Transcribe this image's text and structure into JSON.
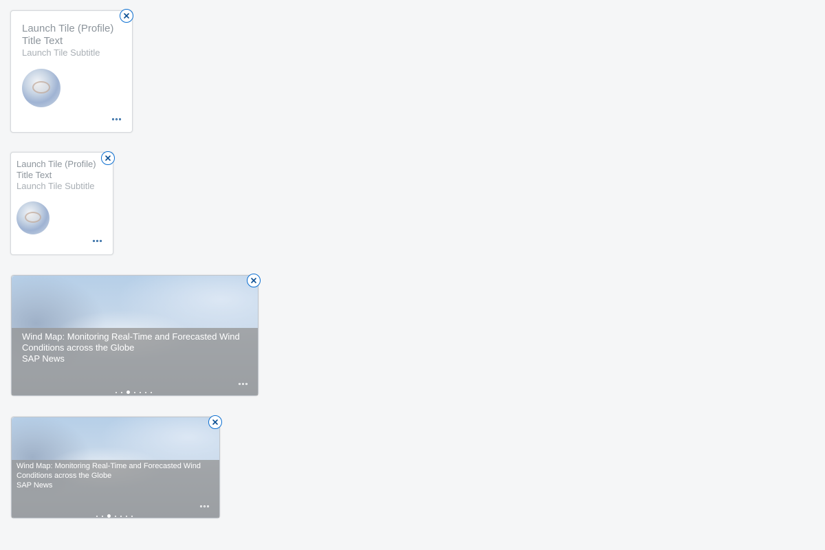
{
  "tiles": [
    {
      "title": "Launch Tile (Profile) Title Text",
      "subtitle": "Launch Tile Subtitle",
      "close_icon": "close-icon",
      "more_icon": "overflow-icon"
    },
    {
      "title": "Launch Tile (Profile) Title Text",
      "subtitle": "Launch Tile Subtitle",
      "close_icon": "close-icon",
      "more_icon": "overflow-icon"
    }
  ],
  "news": [
    {
      "headline": "Wind Map: Monitoring Real-Time and Forecasted Wind Conditions across the Globe",
      "source": "SAP News",
      "page_count": 7,
      "active_page": 3
    },
    {
      "headline": "Wind Map: Monitoring Real-Time and Forecasted Wind Conditions across the Globe",
      "source": "SAP News",
      "page_count": 7,
      "active_page": 3
    }
  ],
  "colors": {
    "accent": "#0a6ed1",
    "icon": "#0a4f93",
    "background": "#f5f6f7"
  }
}
